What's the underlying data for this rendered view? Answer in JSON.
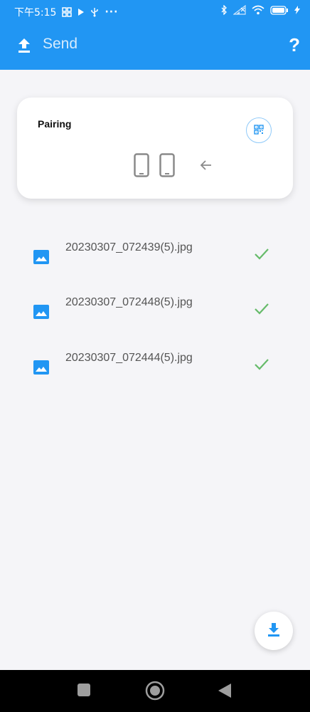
{
  "status_bar": {
    "time": "下午5:15",
    "battery_level": 1.0,
    "icons": [
      "grid-icon",
      "play-icon",
      "usb-icon",
      "more-dots-icon",
      "bluetooth-icon",
      "signal-icon",
      "wifi-icon",
      "battery-icon",
      "charging-icon"
    ],
    "more_dots": "···"
  },
  "appbar": {
    "title": "Send",
    "help_label": "?",
    "background": "#2196f3"
  },
  "pairing": {
    "label": "Pairing"
  },
  "files": [
    {
      "name": "20230307_072439(5).jpg",
      "status": "done"
    },
    {
      "name": "20230307_072448(5).jpg",
      "status": "done"
    },
    {
      "name": "20230307_072444(5).jpg",
      "status": "done"
    }
  ],
  "colors": {
    "accent": "#2196f3",
    "success": "#66bb6a",
    "device_gray": "#8a8a8a"
  }
}
